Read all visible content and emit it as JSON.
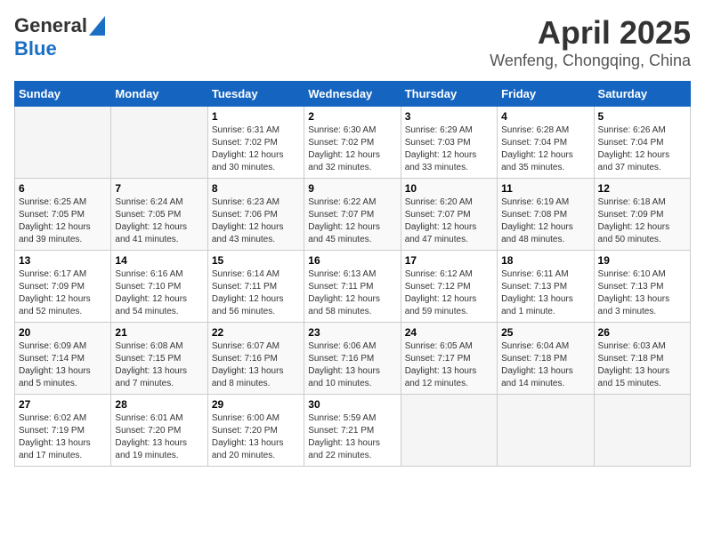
{
  "header": {
    "logo_line1": "General",
    "logo_line2": "Blue",
    "title": "April 2025",
    "subtitle": "Wenfeng, Chongqing, China"
  },
  "calendar": {
    "days_of_week": [
      "Sunday",
      "Monday",
      "Tuesday",
      "Wednesday",
      "Thursday",
      "Friday",
      "Saturday"
    ],
    "weeks": [
      [
        {
          "day": "",
          "info": ""
        },
        {
          "day": "",
          "info": ""
        },
        {
          "day": "1",
          "info": "Sunrise: 6:31 AM\nSunset: 7:02 PM\nDaylight: 12 hours\nand 30 minutes."
        },
        {
          "day": "2",
          "info": "Sunrise: 6:30 AM\nSunset: 7:02 PM\nDaylight: 12 hours\nand 32 minutes."
        },
        {
          "day": "3",
          "info": "Sunrise: 6:29 AM\nSunset: 7:03 PM\nDaylight: 12 hours\nand 33 minutes."
        },
        {
          "day": "4",
          "info": "Sunrise: 6:28 AM\nSunset: 7:04 PM\nDaylight: 12 hours\nand 35 minutes."
        },
        {
          "day": "5",
          "info": "Sunrise: 6:26 AM\nSunset: 7:04 PM\nDaylight: 12 hours\nand 37 minutes."
        }
      ],
      [
        {
          "day": "6",
          "info": "Sunrise: 6:25 AM\nSunset: 7:05 PM\nDaylight: 12 hours\nand 39 minutes."
        },
        {
          "day": "7",
          "info": "Sunrise: 6:24 AM\nSunset: 7:05 PM\nDaylight: 12 hours\nand 41 minutes."
        },
        {
          "day": "8",
          "info": "Sunrise: 6:23 AM\nSunset: 7:06 PM\nDaylight: 12 hours\nand 43 minutes."
        },
        {
          "day": "9",
          "info": "Sunrise: 6:22 AM\nSunset: 7:07 PM\nDaylight: 12 hours\nand 45 minutes."
        },
        {
          "day": "10",
          "info": "Sunrise: 6:20 AM\nSunset: 7:07 PM\nDaylight: 12 hours\nand 47 minutes."
        },
        {
          "day": "11",
          "info": "Sunrise: 6:19 AM\nSunset: 7:08 PM\nDaylight: 12 hours\nand 48 minutes."
        },
        {
          "day": "12",
          "info": "Sunrise: 6:18 AM\nSunset: 7:09 PM\nDaylight: 12 hours\nand 50 minutes."
        }
      ],
      [
        {
          "day": "13",
          "info": "Sunrise: 6:17 AM\nSunset: 7:09 PM\nDaylight: 12 hours\nand 52 minutes."
        },
        {
          "day": "14",
          "info": "Sunrise: 6:16 AM\nSunset: 7:10 PM\nDaylight: 12 hours\nand 54 minutes."
        },
        {
          "day": "15",
          "info": "Sunrise: 6:14 AM\nSunset: 7:11 PM\nDaylight: 12 hours\nand 56 minutes."
        },
        {
          "day": "16",
          "info": "Sunrise: 6:13 AM\nSunset: 7:11 PM\nDaylight: 12 hours\nand 58 minutes."
        },
        {
          "day": "17",
          "info": "Sunrise: 6:12 AM\nSunset: 7:12 PM\nDaylight: 12 hours\nand 59 minutes."
        },
        {
          "day": "18",
          "info": "Sunrise: 6:11 AM\nSunset: 7:13 PM\nDaylight: 13 hours\nand 1 minute."
        },
        {
          "day": "19",
          "info": "Sunrise: 6:10 AM\nSunset: 7:13 PM\nDaylight: 13 hours\nand 3 minutes."
        }
      ],
      [
        {
          "day": "20",
          "info": "Sunrise: 6:09 AM\nSunset: 7:14 PM\nDaylight: 13 hours\nand 5 minutes."
        },
        {
          "day": "21",
          "info": "Sunrise: 6:08 AM\nSunset: 7:15 PM\nDaylight: 13 hours\nand 7 minutes."
        },
        {
          "day": "22",
          "info": "Sunrise: 6:07 AM\nSunset: 7:16 PM\nDaylight: 13 hours\nand 8 minutes."
        },
        {
          "day": "23",
          "info": "Sunrise: 6:06 AM\nSunset: 7:16 PM\nDaylight: 13 hours\nand 10 minutes."
        },
        {
          "day": "24",
          "info": "Sunrise: 6:05 AM\nSunset: 7:17 PM\nDaylight: 13 hours\nand 12 minutes."
        },
        {
          "day": "25",
          "info": "Sunrise: 6:04 AM\nSunset: 7:18 PM\nDaylight: 13 hours\nand 14 minutes."
        },
        {
          "day": "26",
          "info": "Sunrise: 6:03 AM\nSunset: 7:18 PM\nDaylight: 13 hours\nand 15 minutes."
        }
      ],
      [
        {
          "day": "27",
          "info": "Sunrise: 6:02 AM\nSunset: 7:19 PM\nDaylight: 13 hours\nand 17 minutes."
        },
        {
          "day": "28",
          "info": "Sunrise: 6:01 AM\nSunset: 7:20 PM\nDaylight: 13 hours\nand 19 minutes."
        },
        {
          "day": "29",
          "info": "Sunrise: 6:00 AM\nSunset: 7:20 PM\nDaylight: 13 hours\nand 20 minutes."
        },
        {
          "day": "30",
          "info": "Sunrise: 5:59 AM\nSunset: 7:21 PM\nDaylight: 13 hours\nand 22 minutes."
        },
        {
          "day": "",
          "info": ""
        },
        {
          "day": "",
          "info": ""
        },
        {
          "day": "",
          "info": ""
        }
      ]
    ]
  }
}
